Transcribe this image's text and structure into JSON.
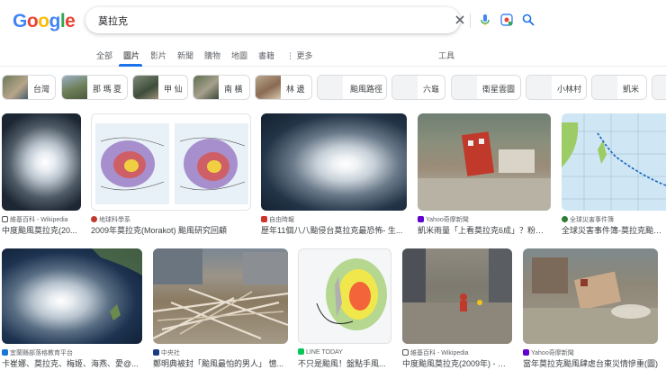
{
  "search": {
    "query": "莫拉克"
  },
  "tabs": [
    {
      "label": "全部"
    },
    {
      "label": "圖片"
    },
    {
      "label": "影片"
    },
    {
      "label": "新聞"
    },
    {
      "label": "購物"
    },
    {
      "label": "地圖"
    },
    {
      "label": "書籍"
    },
    {
      "label": "更多"
    },
    {
      "label": "工具"
    }
  ],
  "chips": [
    {
      "label": "台灣"
    },
    {
      "label": "那 瑪 夏"
    },
    {
      "label": "甲 仙"
    },
    {
      "label": "南 橫"
    },
    {
      "label": "林 邊"
    },
    {
      "label": "颱風路徑"
    },
    {
      "label": "六龜"
    },
    {
      "label": "衛星雲圖"
    },
    {
      "label": "小林村"
    },
    {
      "label": "凱米"
    }
  ],
  "results": [
    {
      "source": "維基百科 - Wikipedia",
      "title": "中度颱風莫拉克(20..."
    },
    {
      "source": "地球科學系",
      "title": "2009年莫拉克(Morakot) 颱風研究回顧"
    },
    {
      "source": "自由時報",
      "title": "歷年11個八八颱侵台莫拉克最恐怖- 生..."
    },
    {
      "source": "Yahoo奇摩新聞",
      "title": "凱米雨量「上看莫拉克6成」？粉專..."
    },
    {
      "source": "全球災害事件簿",
      "title": "全球災害事件簿-莫拉克颱風..."
    },
    {
      "source": "宜蘭縣部落格教育平台",
      "title": "卡崔娜、莫拉克、梅姬、海燕、愛@..."
    },
    {
      "source": "中央社",
      "title": "鄭明典被封「颱風最怕的男人」 憶..."
    },
    {
      "source": "LINE TODAY",
      "title": "不只是颱風！盤點手風..."
    },
    {
      "source": "維基百科 - Wikipedia",
      "title": "中度颱風莫拉克(2009年) - 維..."
    },
    {
      "source": "Yahoo奇摩新聞",
      "title": "當年莫拉克颱風肆虐台東災情慘重(圖)"
    }
  ],
  "colors": {
    "accent": "#1a73e8",
    "text": "#202124",
    "muted": "#5f6368",
    "border": "#dadce0"
  }
}
